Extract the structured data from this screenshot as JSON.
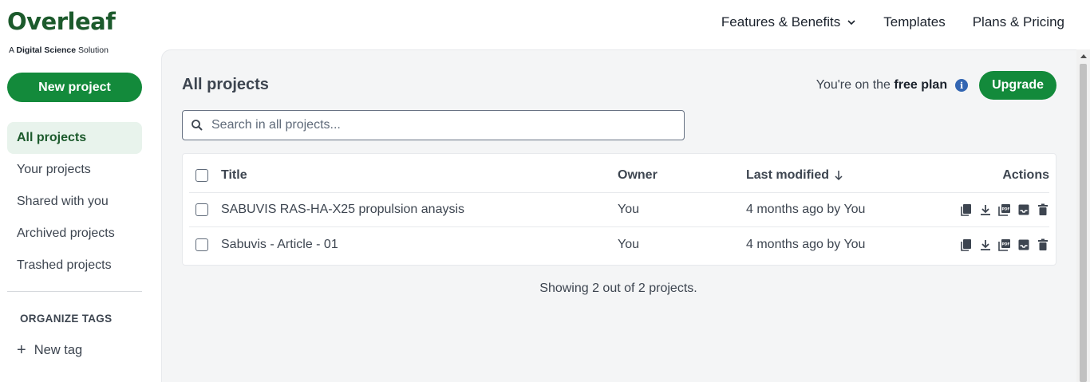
{
  "brand": {
    "logo_text": "Overleaf",
    "sub_prefix": "A",
    "sub_bold": "Digital Science",
    "sub_suffix": "Solution",
    "accent_color": "#138a3b"
  },
  "topnav": {
    "features": "Features & Benefits",
    "templates": "Templates",
    "pricing": "Plans & Pricing"
  },
  "sidebar": {
    "new_project": "New project",
    "items": [
      {
        "label": "All projects",
        "active": true
      },
      {
        "label": "Your projects",
        "active": false
      },
      {
        "label": "Shared with you",
        "active": false
      },
      {
        "label": "Archived projects",
        "active": false
      },
      {
        "label": "Trashed projects",
        "active": false
      }
    ],
    "tags_heading": "ORGANIZE TAGS",
    "new_tag": "New tag"
  },
  "main": {
    "title": "All projects",
    "plan_prefix": "You're on the",
    "plan_name": "free plan",
    "upgrade": "Upgrade",
    "search_placeholder": "Search in all projects...",
    "columns": {
      "title": "Title",
      "owner": "Owner",
      "modified": "Last modified",
      "actions": "Actions"
    },
    "projects": [
      {
        "title": "SABUVIS RAS-HA-X25 propulsion anaysis",
        "owner": "You",
        "modified": "4 months ago by You"
      },
      {
        "title": "Sabuvis - Article - 01",
        "owner": "You",
        "modified": "4 months ago by You"
      }
    ],
    "showing": "Showing 2 out of 2 projects."
  },
  "icons": {
    "actions": [
      "copy-icon",
      "download-icon",
      "pdf-download-icon",
      "archive-icon",
      "trash-icon"
    ]
  }
}
